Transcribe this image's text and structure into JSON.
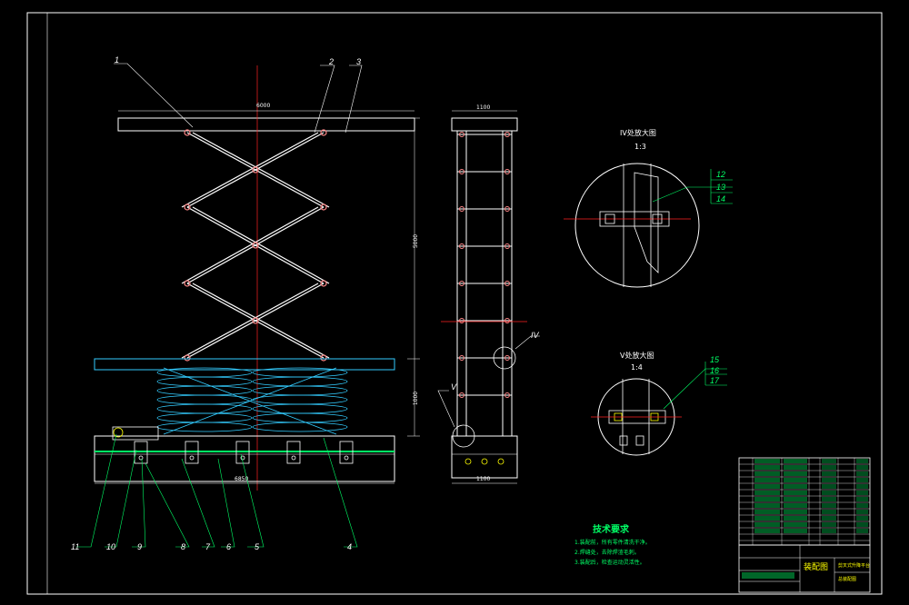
{
  "part_labels": {
    "p1": "1",
    "p2": "2",
    "p3": "3",
    "p4": "4",
    "p5": "5",
    "p6": "6",
    "p7": "7",
    "p8": "8",
    "p9": "9",
    "p10": "10",
    "p11": "11",
    "p12": "12",
    "p13": "13",
    "p14": "14",
    "p15": "15",
    "p16": "16",
    "p17": "17"
  },
  "dimensions": {
    "top_width": "6000",
    "lift_height": "5000",
    "closed_height": "1000",
    "base_length": "6850",
    "side_top_width": "1100",
    "side_base_width": "1100"
  },
  "detail_views": {
    "iv_title": "IV处放大图",
    "iv_scale": "1:3",
    "v_title": "V处放大图",
    "v_scale": "1:4",
    "iv_marker": "IV",
    "v_marker": "V"
  },
  "tech_notes": {
    "title": "技术要求",
    "items": [
      "1.装配前，所有零件清洗干净。",
      "2.焊缝处，去除焊渣毛刺。",
      "3.装配后，检查运动灵活性。"
    ]
  },
  "title_block": {
    "drawing_name": "装配图",
    "project": "剪叉式升降平台",
    "sub": "总装配图"
  },
  "colors": {
    "line": "#ffffff",
    "center": "#ff2222",
    "leader": "#00ff66",
    "spring": "#33ccff",
    "base": "#ffff00",
    "title": "#ffff00"
  }
}
